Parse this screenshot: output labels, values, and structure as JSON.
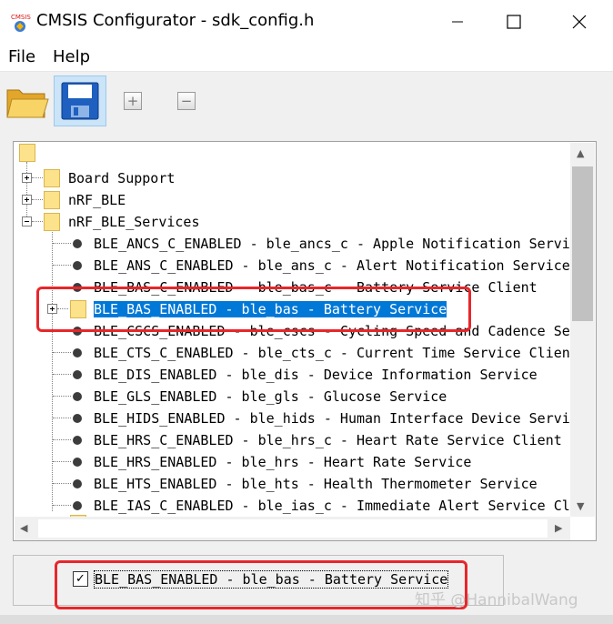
{
  "window": {
    "title": "CMSIS Configurator - sdk_config.h",
    "app_icon": "cmsis-app-icon",
    "minimize": "─",
    "maximize": "☐",
    "close": "✕"
  },
  "menu": {
    "file": "File",
    "help": "Help"
  },
  "toolbar": {
    "open_icon": "folder-open-icon",
    "save_icon": "floppy-save-icon",
    "expand_icon": "expand-all-icon",
    "collapse_icon": "collapse-all-icon",
    "expand_glyph": "+",
    "collapse_glyph": "−"
  },
  "tree": {
    "groups": [
      {
        "label": "Board Support",
        "expanded": false
      },
      {
        "label": "nRF_BLE",
        "expanded": false
      },
      {
        "label": "nRF_BLE_Services",
        "expanded": true
      }
    ],
    "items": [
      {
        "label": "BLE_ANCS_C_ENABLED  - ble_ancs_c - Apple Notification Servi"
      },
      {
        "label": "BLE_ANS_C_ENABLED  - ble_ans_c - Alert Notification Service"
      },
      {
        "label": "BLE_BAS_C_ENABLED  - ble_bas_c - Battery Service Client"
      },
      {
        "label": "BLE_BAS_ENABLED - ble_bas - Battery Service",
        "selected": true
      },
      {
        "label": "BLE_CSCS_ENABLED  - ble_cscs - Cycling Speed and Cadence Se"
      },
      {
        "label": "BLE_CTS_C_ENABLED  - ble_cts_c - Current Time Service Clien"
      },
      {
        "label": "BLE_DIS_ENABLED  - ble_dis - Device Information Service"
      },
      {
        "label": "BLE_GLS_ENABLED  - ble_gls - Glucose Service"
      },
      {
        "label": "BLE_HIDS_ENABLED  - ble_hids - Human Interface Device Servi"
      },
      {
        "label": "BLE_HRS_C_ENABLED  - ble_hrs_c - Heart Rate Service Client"
      },
      {
        "label": "BLE_HRS_ENABLED  - ble_hrs - Heart Rate Service"
      },
      {
        "label": "BLE_HTS_ENABLED  - ble_hts - Health Thermometer Service"
      },
      {
        "label": "BLE_IAS_C_ENABLED  - ble_ias_c - Immediate Alert Service Cl"
      }
    ]
  },
  "scroll": {
    "up": "▲",
    "down": "▼",
    "left": "◀",
    "right": "▶"
  },
  "bottom": {
    "checked": true,
    "check_glyph": "✓",
    "label": "BLE_BAS_ENABLED - ble_bas - Battery Service"
  },
  "watermark": "知乎 @HannibalWang",
  "colors": {
    "selection": "#0078d7",
    "annotation": "#e8262a",
    "folder": "#fce28a"
  }
}
